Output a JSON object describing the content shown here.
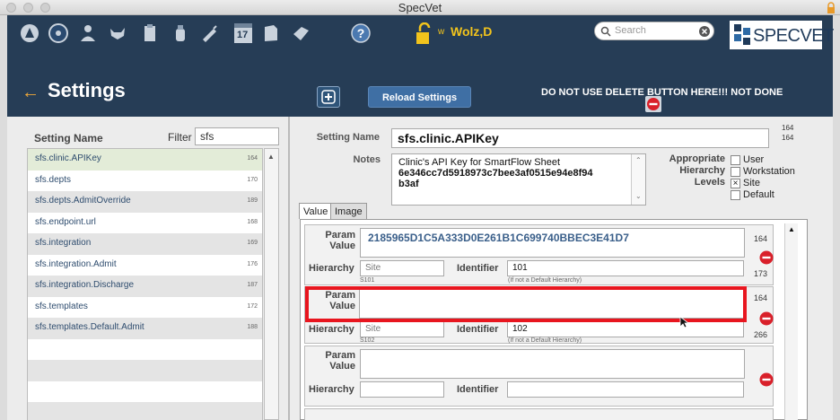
{
  "window": {
    "title": "SpecVet"
  },
  "toolbar": {
    "icons": [
      "paw-icon",
      "dashboard-icon",
      "person-icon",
      "pet-icon",
      "clipboard-icon",
      "bottle-icon",
      "syringe-icon",
      "calendar-icon",
      "document-icon",
      "checkin-icon",
      "help-icon"
    ],
    "calendar_day": "17",
    "user_prefix": "w",
    "user_name": "Wolz,D",
    "search_placeholder": "Search",
    "logo_text": "SPECVET"
  },
  "header": {
    "title": "Settings",
    "reload_label": "Reload Settings",
    "warning": "DO NOT USE DELETE BUTTON HERE!!! NOT DONE"
  },
  "left": {
    "column_label": "Setting Name",
    "filter_label": "Filter",
    "filter_value": "sfs",
    "items": [
      {
        "name": "sfs.clinic.APIKey",
        "num": "164"
      },
      {
        "name": "sfs.depts",
        "num": "170"
      },
      {
        "name": "sfs.depts.AdmitOverride",
        "num": "189"
      },
      {
        "name": "sfs.endpoint.url",
        "num": "168"
      },
      {
        "name": "sfs.integration",
        "num": "169"
      },
      {
        "name": "sfs.integration.Admit",
        "num": "176"
      },
      {
        "name": "sfs.integration.Discharge",
        "num": "187"
      },
      {
        "name": "sfs.templates",
        "num": "172"
      },
      {
        "name": "sfs.templates.Default.Admit",
        "num": "188"
      }
    ]
  },
  "detail": {
    "setting_name_label": "Setting Name",
    "setting_name": "sfs.clinic.APIKey",
    "id_top": "164",
    "id_bottom": "164",
    "notes_label": "Notes",
    "notes_line1": "Clinic's API Key for SmartFlow Sheet",
    "notes_line2": "6e346cc7d5918973c7bee3af0515e94e8f94",
    "notes_line3": "b3af",
    "hierarchy_label_1": "Appropriate",
    "hierarchy_label_2": "Hierarchy",
    "hierarchy_label_3": "Levels",
    "levels": [
      {
        "label": "User",
        "checked": ""
      },
      {
        "label": "Workstation",
        "checked": ""
      },
      {
        "label": "Site",
        "checked": "×"
      },
      {
        "label": "Default",
        "checked": ""
      }
    ],
    "tabs": [
      "Value",
      "Image"
    ]
  },
  "params": [
    {
      "label_1": "Param",
      "label_2": "Value",
      "value": "2185965D1C5A333D0E261B1C699740BBEC3E41D7",
      "num": "164",
      "hierarchy_label": "Hierarchy",
      "hierarchy_value": "Site",
      "hierarchy_sub": "S101",
      "identifier_label": "Identifier",
      "identifier_value": "101",
      "identifier_hint": "(If not a Default Hierarchy)",
      "row_num": "173"
    },
    {
      "label_1": "Param",
      "label_2": "Value",
      "value": "",
      "num": "164",
      "hierarchy_label": "Hierarchy",
      "hierarchy_value": "Site",
      "hierarchy_sub": "S102",
      "identifier_label": "Identifier",
      "identifier_value": "102",
      "identifier_hint": "(If not a Default Hierarchy)",
      "row_num": "266"
    },
    {
      "label_1": "Param",
      "label_2": "Value",
      "value": "",
      "hierarchy_label": "Hierarchy",
      "identifier_label": "Identifier"
    }
  ],
  "colors": {
    "header_bg": "#263d56",
    "accent_yellow": "#f2c41c",
    "highlight_red": "#e8161f",
    "delete_red": "#d9202a"
  }
}
